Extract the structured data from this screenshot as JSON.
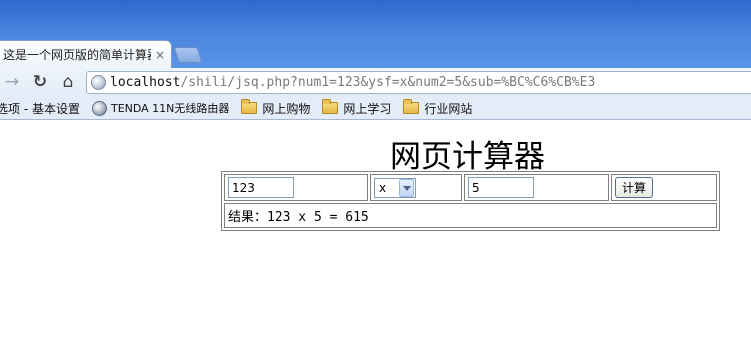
{
  "browser": {
    "tab_title": "这是一个网页版的简单计算器",
    "tab_close": "×",
    "url_host": "localhost",
    "url_rest": "/shili/jsq.php?num1=123&ysf=x&num2=5&sub=%BC%C6%CB%E3"
  },
  "bookmarks": {
    "items": [
      {
        "label": "选项 - 基本设置",
        "icon": "none"
      },
      {
        "label": "TENDA 11N无线路由器",
        "icon": "globe-icon"
      },
      {
        "label": "网上购物",
        "icon": "folder-icon"
      },
      {
        "label": "网上学习",
        "icon": "folder-icon"
      },
      {
        "label": "行业网站",
        "icon": "folder-icon"
      }
    ]
  },
  "page": {
    "heading": "网页计算器",
    "num1": "123",
    "operator": "x",
    "num2": "5",
    "submit_label": "计算",
    "result": "结果：123 x 5 = 615"
  }
}
